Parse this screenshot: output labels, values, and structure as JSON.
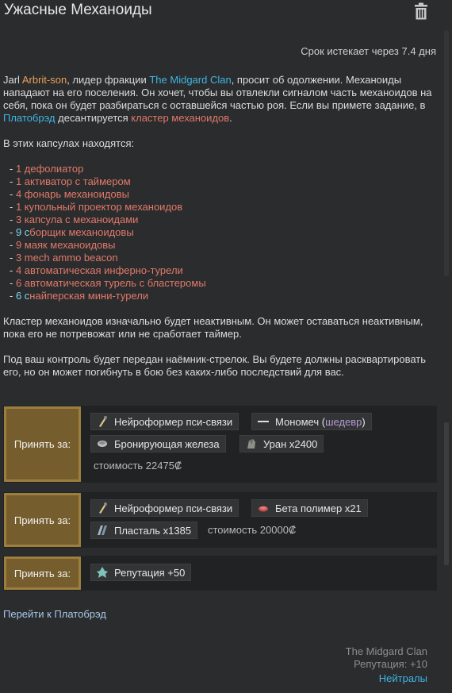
{
  "header": {
    "title": "Ужасные Механоиды",
    "expires": "Срок истекает через 7.4 дня"
  },
  "description": {
    "p1": [
      {
        "t": "Jarl ",
        "c": ""
      },
      {
        "t": "Arbrit-son",
        "c": "hl-orange"
      },
      {
        "t": ", лидер фракции ",
        "c": ""
      },
      {
        "t": "The Midgard Clan",
        "c": "hl-blue"
      },
      {
        "t": ", просит об одолжении. Механоиды нападают на его поселения. Он хочет, чтобы вы отвлекли сигналом часть механоидов на себя, пока он будет разбираться с оставшейся частью роя. Если вы примете задание, в ",
        "c": ""
      },
      {
        "t": "Платобрэд",
        "c": "hl-blue"
      },
      {
        "t": " десантируется ",
        "c": ""
      },
      {
        "t": "кластер механоидов",
        "c": "hl-red"
      },
      {
        "t": ".",
        "c": ""
      }
    ],
    "capsules_intro": "В этих капсулах находятся:",
    "capsules": [
      {
        "n": "1",
        "pre": "",
        "name": "дефолиатор",
        "color": "hl-red"
      },
      {
        "n": "1",
        "pre": "",
        "name": "активатор с таймером",
        "color": "hl-red"
      },
      {
        "n": "4",
        "pre": "",
        "name": "фонарь механоидовы",
        "color": "hl-red"
      },
      {
        "n": "1",
        "pre": "",
        "name": "купольный проектор механоидов",
        "color": "hl-red"
      },
      {
        "n": "3",
        "pre": "",
        "name": "капсула с механоидами",
        "color": "hl-red"
      },
      {
        "n": "9",
        "pre": "с",
        "name": "борщик механоидовы",
        "color": "hl-red",
        "ncolor": "hl-cyan"
      },
      {
        "n": "9",
        "pre": "",
        "name": "маяк механоидовы",
        "color": "hl-red"
      },
      {
        "n": "3",
        "pre": "",
        "name": "mech ammo beacon",
        "color": "hl-red"
      },
      {
        "n": "4",
        "pre": "",
        "name": "автоматическая инферно-турели",
        "color": "hl-red"
      },
      {
        "n": "6",
        "pre": "",
        "name": "автоматическая турель с бластеромы",
        "color": "hl-red"
      },
      {
        "n": "6",
        "pre": "с",
        "name": "найперская мини-турели",
        "color": "hl-red",
        "ncolor": "hl-cyan"
      }
    ],
    "p2": "Кластер механоидов изначально будет неактивным. Он может оставаться неактивным, пока его не потревожат или не сработает таймер.",
    "p3": "Под ваш контроль будет передан наёмник-стрелок. Вы будете должны расквартировать его, но он может погибнуть в бою без каких-либо последствий для вас."
  },
  "offers": [
    {
      "accept_label": "Принять за:",
      "items": [
        {
          "icon": "psylink-neuroformer-icon",
          "label": "Нейроформер пси-связи"
        },
        {
          "icon": "monosword-icon",
          "label": "Мономеч (",
          "quality": "шедевр",
          "suffix": ")"
        },
        {
          "icon": "armor-gland-icon",
          "label": "Бронирующая железа"
        },
        {
          "icon": "uranium-icon",
          "label": "Уран x2400"
        }
      ],
      "cost": "стоимость 22475₡"
    },
    {
      "accept_label": "Принять за:",
      "items": [
        {
          "icon": "psylink-neuroformer-icon",
          "label": "Нейроформер пси-связи"
        },
        {
          "icon": "beta-polymer-icon",
          "label": "Бета полимер x21"
        },
        {
          "icon": "plasteel-icon",
          "label": "Пласталь x1385"
        }
      ],
      "cost": "стоимость 20000₡"
    },
    {
      "accept_label": "Принять за:",
      "items": [
        {
          "icon": "reputation-icon",
          "label": "Репутация +50"
        }
      ]
    }
  ],
  "footer": {
    "goto_label": "Перейти к Платобрэд",
    "faction_name": "The Midgard Clan",
    "faction_reputation": "Репутация: +10",
    "faction_status": "Нейтралы"
  },
  "colors": {
    "accent_blue": "#3fb6e6",
    "item_red": "#e0796b",
    "name_orange": "#e7a25a",
    "accept_bg": "#765d2d"
  }
}
